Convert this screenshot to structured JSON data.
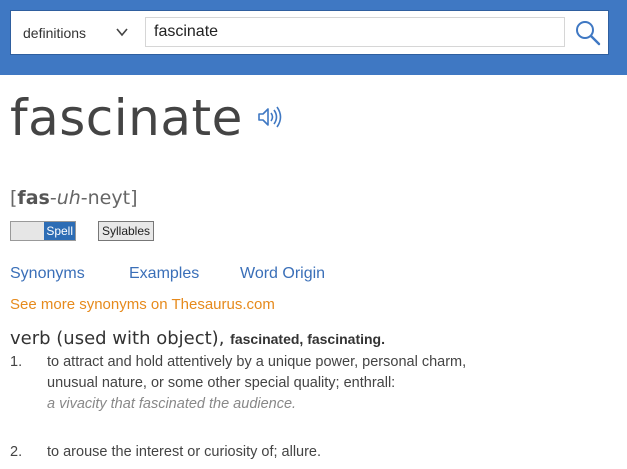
{
  "search": {
    "mode_label": "definitions",
    "query": "fascinate",
    "icons": {
      "dropdown": "chevron-down-icon",
      "submit": "search-icon"
    }
  },
  "entry": {
    "word": "fascinate",
    "audio_icon": "speaker-icon",
    "pronunciation": {
      "open": "[",
      "stressed": "fas",
      "sep1": "-",
      "unstressed": "uh",
      "sep2": "-",
      "last": "neyt",
      "close": "]"
    },
    "spell_label": "Spell",
    "syllables_label": "Syllables",
    "links": {
      "synonyms": "Synonyms",
      "examples": "Examples",
      "word_origin": "Word Origin"
    },
    "thesaurus_link": "See more synonyms on Thesaurus.com",
    "pos": "verb (used with object),",
    "inflections": "fascinated, fascinating.",
    "definitions": [
      {
        "num": "1.",
        "line1": "to attract and hold attentively by a unique power, personal charm,",
        "line2": "unusual nature, or some other special quality; enthrall:",
        "example": "a vivacity that fascinated the audience."
      },
      {
        "num": "2.",
        "line1": "to arouse the interest or curiosity of; allure."
      }
    ]
  },
  "colors": {
    "header_bg": "#3f78c3",
    "link": "#3a6fb8",
    "thesaurus_link": "#e68a1c",
    "spell_bg": "#2d6db5"
  }
}
